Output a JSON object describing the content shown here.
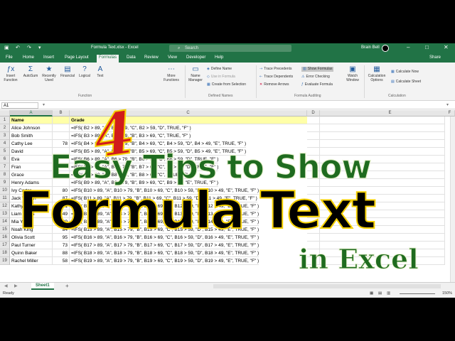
{
  "titlebar": {
    "file_title": "Formula Text.xlsx  -  Excel",
    "search_placeholder": "Search",
    "user_name": "Brain Bell",
    "minimize": "–",
    "maximize": "□",
    "close": "✕"
  },
  "menu": [
    "File",
    "Home",
    "Insert",
    "Page Layout",
    "Formulas",
    "Data",
    "Review",
    "View",
    "Developer",
    "Help"
  ],
  "share_label": "Share",
  "ribbon": {
    "insert_function": "Insert\nFunction",
    "autosum": "AutoSum",
    "recently_used": "Recently\nUsed",
    "financial": "Financial",
    "logical": "Logical",
    "text": "Text",
    "more_functions": "More\nFunctions",
    "name_manager": "Name\nManager",
    "define_name": "Define Name",
    "use_in_formula": "Use in Formula",
    "create_from_selection": "Create from Selection",
    "defined_names_group": "Defined Names",
    "trace_precedents": "Trace Precedents",
    "trace_dependents": "Trace Dependents",
    "remove_arrows": "Remove Arrows",
    "show_formulas": "Show Formulas",
    "error_checking": "Error Checking",
    "evaluate_formula": "Evaluate Formula",
    "formula_auditing_group": "Formula Auditing",
    "watch_window": "Watch\nWindow",
    "calculation_options": "Calculation\nOptions",
    "calculate_now": "Calculate Now",
    "calculate_sheet": "Calculate Sheet",
    "calculation_group": "Calculation",
    "function_library_group": "Function"
  },
  "formula_bar": {
    "name_box": "A1"
  },
  "columns": [
    "A",
    "B",
    "C",
    "D",
    "E",
    "F"
  ],
  "rows": [
    {
      "n": "1",
      "name": "Name",
      "score": "",
      "formula": "Grade"
    },
    {
      "n": "2",
      "name": "Alice Johnson",
      "score": "",
      "formula": "=IFS( B2 > 89, \"A\", B2 > 69, \"C\", B2 > 59, \"D\", TRUE, \"F\" )"
    },
    {
      "n": "3",
      "name": "Bob Smith",
      "score": "",
      "formula": "=IFS( B3 > 89, \"A\", B3 > 79, \"B\", B3 > 69, \"C\", TRUE, \"F\" )"
    },
    {
      "n": "4",
      "name": "Cathy Lee",
      "score": "78",
      "formula": "=IFS( B4 > 89, \"A\", B4 > 79, \"B\", B4 > 69, \"C\", B4 > 59, \"D\", B4 > 49, \"E\", TRUE, \"F\" )"
    },
    {
      "n": "5",
      "name": "David",
      "score": "",
      "formula": "=IFS( B5 > 89, \"A\", B5 > 79, \"B\", B5 > 69, \"C\", B5 > 59, \"D\", B5 > 49, \"E\", TRUE, \"F\" )"
    },
    {
      "n": "6",
      "name": "Eva",
      "score": "",
      "formula": "=IFS( B6 > 89, \"A\", B6 > 79, \"B\", B6 > 69, \"C\", B6 > 59, \"D\", TRUE, \"F\" )"
    },
    {
      "n": "7",
      "name": "Fran",
      "score": "",
      "formula": "=IFS( B7 > 89, \"A\", B7 > 79, \"B\", B7 > 69, \"C\", B7 > 59, \"D\", TRUE, \"F\" )"
    },
    {
      "n": "8",
      "name": "Grace",
      "score": "",
      "formula": "=IFS( B8 > 89, \"A\", B8 > 79, \"B\", B8 > 69, \"C\", TRUE, \"F\" )"
    },
    {
      "n": "9",
      "name": "Henry Adams",
      "score": "",
      "formula": "=IFS( B9 > 89, \"A\", B9 > 79, \"B\", B9 > 69, \"C\", B9 > 49, \"E\", TRUE, \"F\" )"
    },
    {
      "n": "10",
      "name": "Ivy Carter",
      "score": "80",
      "formula": "=IFS( B10 > 89, \"A\", B10 > 79, \"B\", B10 > 69, \"C\", B10 > 59, \"D\", B10 > 49, \"E\", TRUE, \"F\" )"
    },
    {
      "n": "11",
      "name": "Jack Wilson",
      "score": "87",
      "formula": "=IFS( B11 > 89, \"A\", B11 > 79, \"B\", B11 > 69, \"C\", B11 > 59, \"D\", B11 > 49, \"E\", TRUE, \"F\" )"
    },
    {
      "n": "12",
      "name": "Kathy Clark",
      "score": "91",
      "formula": "=IFS( B12 > 89, \"A\", B12 > 79, \"B\", B12 > 69, \"C\", B12 > 59, \"D\", B12 > 49, \"E\", TRUE, \"F\" )"
    },
    {
      "n": "13",
      "name": "Liam Lewis",
      "score": "49",
      "formula": "=IFS( B13 > 89, \"A\", B13 > 79, \"B\", B13 > 69, \"C\", B13 > 59, \"D\", B13 > 49, \"E\", TRUE, \"F\" )"
    },
    {
      "n": "14",
      "name": "Mia Young",
      "score": "89",
      "formula": "=IFS( B14 > 89, \"A\", B14 > 79, \"B\", B14 > 69, \"C\", B14 > 59, \"D\", B14 > 49, \"E\", TRUE, \"F\" )"
    },
    {
      "n": "15",
      "name": "Noah King",
      "score": "84",
      "formula": "=IFS( B15 > 89, \"A\", B15 > 79, \"B\", B15 > 69, \"C\", B15 > 59, \"D\", B15 > 49, \"E\", TRUE, \"F\" )"
    },
    {
      "n": "16",
      "name": "Olivia Scott",
      "score": "95",
      "formula": "=IFS( B16 > 89, \"A\", B16 > 79, \"B\", B16 > 69, \"C\", B16 > 59, \"D\", B16 > 49, \"E\", TRUE, \"F\" )"
    },
    {
      "n": "17",
      "name": "Paul Turner",
      "score": "73",
      "formula": "=IFS( B17 > 89, \"A\", B17 > 79, \"B\", B17 > 69, \"C\", B17 > 59, \"D\", B17 > 49, \"E\", TRUE, \"F\" )"
    },
    {
      "n": "18",
      "name": "Quinn Baker",
      "score": "88",
      "formula": "=IFS( B18 > 89, \"A\", B18 > 79, \"B\", B18 > 69, \"C\", B18 > 59, \"D\", B18 > 49, \"E\", TRUE, \"F\" )"
    },
    {
      "n": "19",
      "name": "Rachel Miller",
      "score": "58",
      "formula": "=IFS( B19 > 89, \"A\", B19 > 79, \"B\", B19 > 69, \"C\", B19 > 59, \"D\", B19 > 49, \"E\", TRUE, \"F\" )"
    }
  ],
  "sheet_tab": "Sheet1",
  "add_sheet": "+",
  "status": {
    "ready": "Ready",
    "zoom": "150%"
  },
  "overlay": {
    "number": "4",
    "line1": "Easy Tips to Show",
    "line2": "Formula Text",
    "line3": "in Excel"
  },
  "colors": {
    "excel_green": "#217346",
    "header_yellow": "#ffffa8",
    "title_green": "#1f6b1f",
    "number_red": "#d11b1b",
    "outline_yellow": "#f5d000"
  }
}
